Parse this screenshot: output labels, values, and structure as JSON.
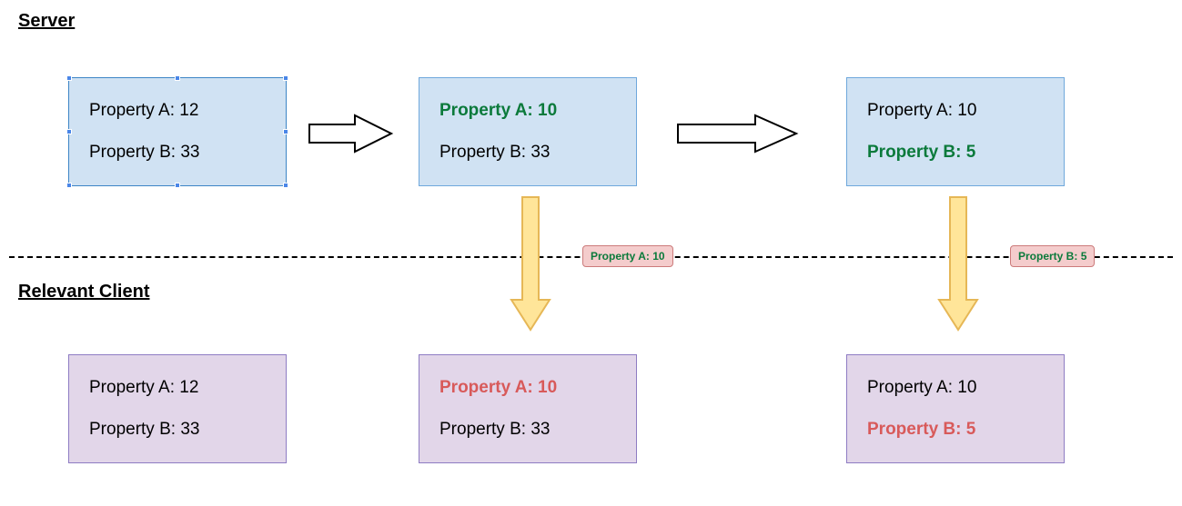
{
  "headings": {
    "server": "Server",
    "client": "Relevant Client"
  },
  "labels": {
    "propA": "Property A:",
    "propB": "Property B:"
  },
  "server_states": [
    {
      "a": 12,
      "a_changed": false,
      "b": 33,
      "b_changed": false
    },
    {
      "a": 10,
      "a_changed": true,
      "b": 33,
      "b_changed": false
    },
    {
      "a": 10,
      "a_changed": false,
      "b": 5,
      "b_changed": true
    }
  ],
  "client_states": [
    {
      "a": 12,
      "a_changed": false,
      "b": 33,
      "b_changed": false
    },
    {
      "a": 10,
      "a_changed": true,
      "b": 33,
      "b_changed": false
    },
    {
      "a": 10,
      "a_changed": false,
      "b": 5,
      "b_changed": true
    }
  ],
  "payloads": [
    {
      "label": "Property A:",
      "value": 10
    },
    {
      "label": "Property B:",
      "value": 5
    }
  ],
  "colors": {
    "server_fill": "#d0e2f3",
    "server_border": "#6fa8dc",
    "client_fill": "#e2d6e9",
    "client_border": "#8e7cc3",
    "payload_fill": "#f4cccc",
    "payload_border": "#cc7b7b",
    "arrow_down_fill": "#ffe599",
    "arrow_down_border": "#e6b756",
    "changed_server": "#0b7a3b",
    "changed_client": "#d85a5a"
  }
}
